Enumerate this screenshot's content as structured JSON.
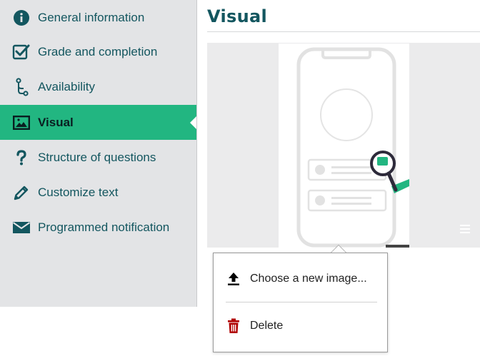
{
  "sidebar": {
    "items": [
      {
        "label": "General information",
        "icon": "info-circle-icon"
      },
      {
        "label": "Grade and completion",
        "icon": "checkbox-check-icon"
      },
      {
        "label": "Availability",
        "icon": "branch-icon"
      },
      {
        "label": "Visual",
        "icon": "image-icon",
        "active": true
      },
      {
        "label": "Structure of questions",
        "icon": "question-mark-icon"
      },
      {
        "label": "Customize text",
        "icon": "pencil-icon"
      },
      {
        "label": "Programmed notification",
        "icon": "envelope-icon"
      }
    ]
  },
  "main": {
    "title": "Visual",
    "preview": {
      "menu_icon": "hamburger-menu-icon"
    }
  },
  "popup": {
    "items": [
      {
        "label": "Choose a new image...",
        "icon": "upload-icon"
      },
      {
        "label": "Delete",
        "icon": "trash-icon"
      }
    ]
  },
  "colors": {
    "accent": "#22b681",
    "text_primary": "#13565f",
    "sidebar_bg": "#e3e4e6",
    "delete_icon": "#b00000"
  }
}
